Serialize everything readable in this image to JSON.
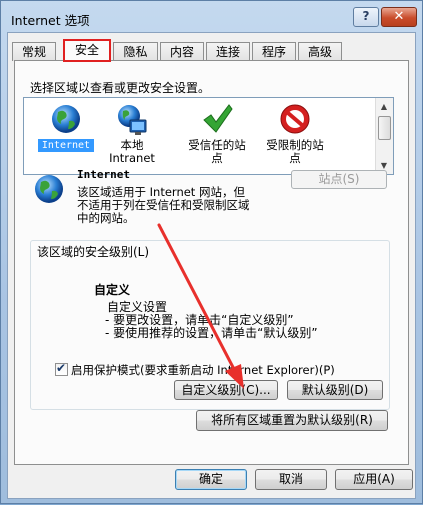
{
  "window": {
    "title": "Internet 选项",
    "help_label": "?",
    "close_label": "✕"
  },
  "tabs": [
    {
      "label": "常规"
    },
    {
      "label": "安全"
    },
    {
      "label": "隐私"
    },
    {
      "label": "内容"
    },
    {
      "label": "连接"
    },
    {
      "label": "程序"
    },
    {
      "label": "高级"
    }
  ],
  "security": {
    "select_zone_label": "选择区域以查看或更改安全设置。",
    "zones": [
      {
        "label": "Internet",
        "icon": "globe-icon"
      },
      {
        "label": "本地\nIntranet",
        "icon": "intranet-icon"
      },
      {
        "label": "受信任的站\n点",
        "icon": "checkmark-icon"
      },
      {
        "label": "受限制的站\n点",
        "icon": "no-entry-icon"
      }
    ],
    "zone_title": "Internet",
    "zone_description": "该区域适用于 Internet 网站，但\n不适用于列在受信任和受限制区域\n中的网站。",
    "sites_button": "站点(S)",
    "security_level_group": "该区域的安全级别(L)",
    "level_name": "自定义",
    "level_desc_1": "自定义设置",
    "level_desc_2": "- 要更改设置，请单击“自定义级别”",
    "level_desc_3": "- 要使用推荐的设置，请单击“默认级别”",
    "protected_mode_label": "启用保护模式(要求重新启动 Internet Explorer)(P)",
    "protected_mode_checked": true,
    "custom_level_button": "自定义级别(C)...",
    "default_level_button": "默认级别(D)",
    "reset_all_button": "将所有区域重置为默认级别(R)"
  },
  "footer": {
    "ok_label": "确定",
    "cancel_label": "取消",
    "apply_label": "应用(A)"
  },
  "colors": {
    "active_tab_highlight": "#e02020",
    "annotation_arrow": "#e8302c",
    "selected_zone": "#3399ff"
  }
}
